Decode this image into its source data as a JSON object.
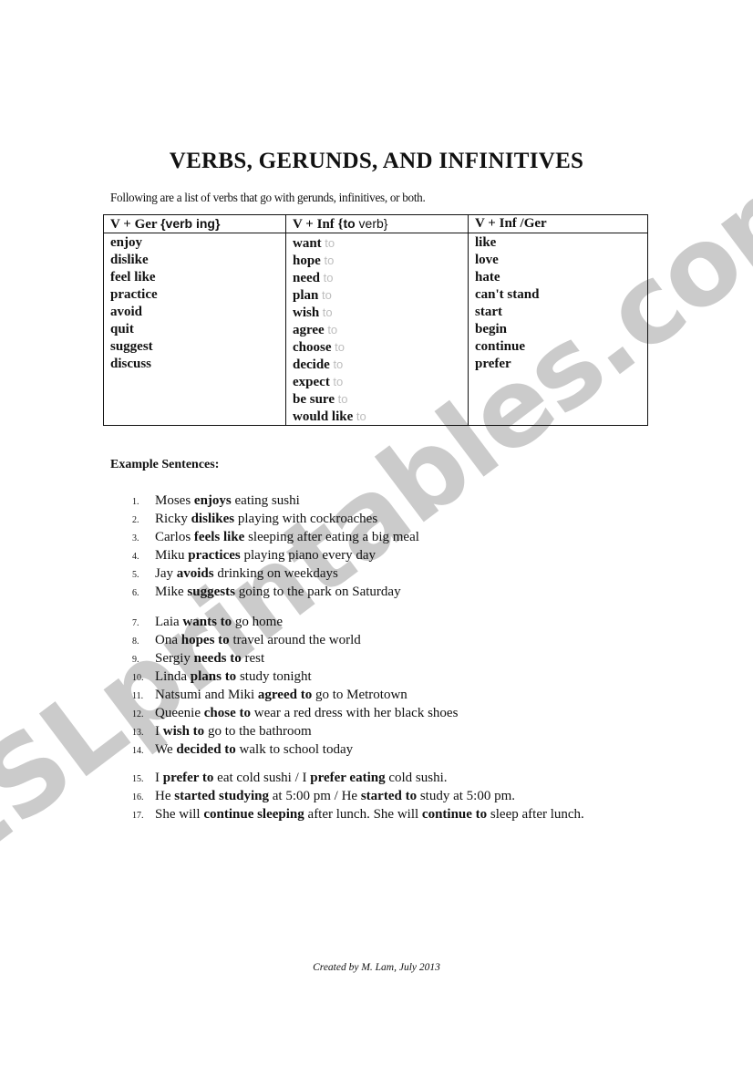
{
  "watermark": "ESLprintables.com",
  "title": "VERBS, GERUNDS, AND INFINITIVES",
  "intro": "Following are a list of verbs that go with gerunds, infinitives, or both.",
  "table": {
    "headers": [
      {
        "main": "V + Ger ",
        "note": "{verb ing}"
      },
      {
        "main": "V + Inf {",
        "note_bold": "to",
        "note": " verb}"
      },
      {
        "main": "V + Inf /Ger"
      }
    ],
    "gerund_verbs": [
      "enjoy",
      "dislike",
      "feel like",
      "practice",
      "avoid",
      "quit",
      "suggest",
      "discuss"
    ],
    "infinitive_verbs": [
      "want",
      "hope",
      "need",
      "plan",
      "wish",
      "agree",
      "choose",
      "decide",
      "expect",
      "be sure",
      "would like"
    ],
    "infinitive_suffix": "to",
    "both_verbs": [
      "like",
      "love",
      "hate",
      "can't stand",
      "start",
      "begin",
      "continue",
      "prefer"
    ]
  },
  "examples_heading": "Example Sentences:",
  "examples": [
    {
      "n": "1.",
      "parts": [
        [
          "Moses ",
          0
        ],
        [
          "enjoys",
          1
        ],
        [
          " eating sushi",
          0
        ]
      ]
    },
    {
      "n": "2.",
      "parts": [
        [
          "Ricky ",
          0
        ],
        [
          "dislikes",
          1
        ],
        [
          " playing with cockroaches",
          0
        ]
      ]
    },
    {
      "n": "3.",
      "parts": [
        [
          "Carlos ",
          0
        ],
        [
          "feels like",
          1
        ],
        [
          " sleeping after eating a big meal",
          0
        ]
      ]
    },
    {
      "n": "4.",
      "parts": [
        [
          "Miku ",
          0
        ],
        [
          "practices",
          1
        ],
        [
          " playing piano every day",
          0
        ]
      ]
    },
    {
      "n": "5.",
      "parts": [
        [
          "Jay ",
          0
        ],
        [
          "avoids",
          1
        ],
        [
          " drinking on weekdays",
          0
        ]
      ]
    },
    {
      "n": "6.",
      "parts": [
        [
          "Mike ",
          0
        ],
        [
          "suggests",
          1
        ],
        [
          " going to the park on Saturday",
          0
        ]
      ]
    },
    {
      "n": "7.",
      "parts": [
        [
          "Laia ",
          0
        ],
        [
          "wants to",
          1
        ],
        [
          " go home",
          0
        ]
      ]
    },
    {
      "n": "8.",
      "parts": [
        [
          "Ona ",
          0
        ],
        [
          "hopes to",
          1
        ],
        [
          " travel around the world",
          0
        ]
      ]
    },
    {
      "n": "9.",
      "parts": [
        [
          "Sergiy ",
          0
        ],
        [
          "needs to",
          1
        ],
        [
          " rest",
          0
        ]
      ]
    },
    {
      "n": "10.",
      "parts": [
        [
          "Linda ",
          0
        ],
        [
          "plans to",
          1
        ],
        [
          " study tonight",
          0
        ]
      ]
    },
    {
      "n": "11.",
      "parts": [
        [
          "Natsumi and Miki ",
          0
        ],
        [
          "agreed to",
          1
        ],
        [
          " go to Metrotown",
          0
        ]
      ]
    },
    {
      "n": "12.",
      "parts": [
        [
          "Queenie ",
          0
        ],
        [
          "chose to",
          1
        ],
        [
          " wear a red dress with her black shoes",
          0
        ]
      ]
    },
    {
      "n": "13.",
      "parts": [
        [
          "I ",
          0
        ],
        [
          "wish to",
          1
        ],
        [
          " go to the bathroom",
          0
        ]
      ]
    },
    {
      "n": "14.",
      "parts": [
        [
          "We ",
          0
        ],
        [
          "decided to",
          1
        ],
        [
          " walk to school today",
          0
        ]
      ]
    },
    {
      "n": "15.",
      "parts": [
        [
          "I ",
          0
        ],
        [
          "prefer to",
          1
        ],
        [
          " eat cold sushi / I ",
          0
        ],
        [
          "prefer eating",
          1
        ],
        [
          " cold sushi.",
          0
        ]
      ]
    },
    {
      "n": "16.",
      "parts": [
        [
          "He ",
          0
        ],
        [
          "started studying",
          1
        ],
        [
          " at 5:00 pm  / He ",
          0
        ],
        [
          "started to",
          1
        ],
        [
          " study at 5:00 pm.",
          0
        ]
      ]
    },
    {
      "n": "17.",
      "parts": [
        [
          "She will ",
          0
        ],
        [
          "continue sleeping",
          1
        ],
        [
          " after lunch. She will ",
          0
        ],
        [
          "continue to",
          1
        ],
        [
          " sleep after lunch.",
          0
        ]
      ]
    }
  ],
  "example_groups": [
    [
      0,
      6
    ],
    [
      6,
      14
    ],
    [
      14,
      17
    ]
  ],
  "footer": "Created by M. Lam, July 2013"
}
